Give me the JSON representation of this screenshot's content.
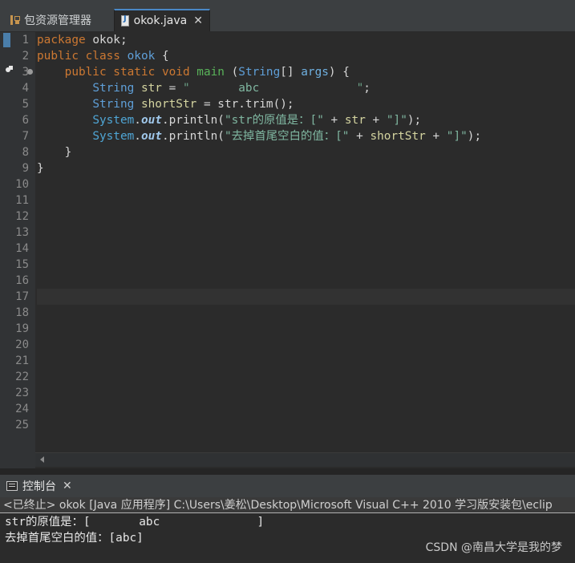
{
  "tabs": {
    "explorer_label": "包资源管理器",
    "file_label": "okok.java",
    "close_glyph": "✕"
  },
  "line_numbers": [
    "1",
    "2",
    "3",
    "4",
    "5",
    "6",
    "7",
    "8",
    "9",
    "10",
    "11",
    "12",
    "13",
    "14",
    "15",
    "16",
    "17",
    "18",
    "19",
    "20",
    "21",
    "22",
    "23",
    "24",
    "25"
  ],
  "code": {
    "l1": {
      "kw": "package",
      "name": " okok;"
    },
    "l2": {
      "kw1": "public",
      "kw2": " class",
      "name": " okok",
      "brace": " {"
    },
    "l3": {
      "indent": "    ",
      "kw1": "public",
      "kw2": " static",
      "kw3": " void",
      "name": " main",
      "p1": " (",
      "type": "String",
      "p2": "[] ",
      "param": "args",
      "p3": ") {"
    },
    "l4": {
      "indent": "        ",
      "type": "String",
      "var": " str",
      "eq": " = ",
      "quote1": "\"",
      "content": "       abc              ",
      "quote2": "\"",
      "end": ";"
    },
    "l5": {
      "indent": "        ",
      "type": "String",
      "var": " shortStr",
      "eq": " = ",
      "rhs": "str.trim();"
    },
    "l6": {
      "indent": "        ",
      "sys": "System",
      "dot1": ".",
      "out": "out",
      "call": ".println(",
      "s1": "\"str的原值是：[\"",
      "plus1": " + ",
      "v": "str",
      "plus2": " + ",
      "s2": "\"]\"",
      "end": ");"
    },
    "l7": {
      "indent": "        ",
      "sys": "System",
      "dot1": ".",
      "out": "out",
      "call": ".println(",
      "s1": "\"去掉首尾空白的值：[\"",
      "plus1": " + ",
      "v": "shortStr",
      "plus2": " + ",
      "s2": "\"]\"",
      "end": ");"
    },
    "l8": {
      "indent": "    ",
      "brace": "}"
    },
    "l9": {
      "brace": "}"
    }
  },
  "console": {
    "tab_label": "控制台",
    "close_glyph": "✕",
    "description": "<已终止> okok [Java 应用程序] C:\\Users\\姜松\\Desktop\\Microsoft Visual C++ 2010 学习版安装包\\eclip",
    "output": [
      "str的原值是：[       abc              ]",
      "去掉首尾空白的值：[abc]"
    ]
  },
  "watermark": "CSDN @南昌大学是我的梦"
}
